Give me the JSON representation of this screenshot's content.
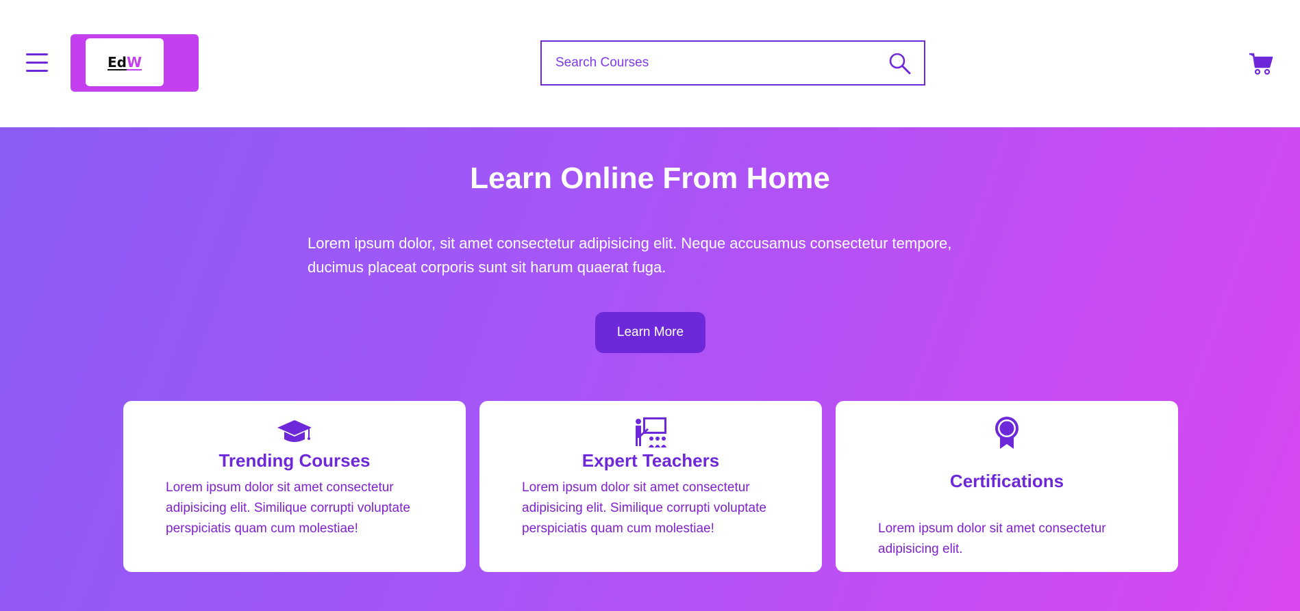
{
  "header": {
    "logo": {
      "part1": "Ed",
      "part2": "W"
    },
    "search": {
      "placeholder": "Search Courses"
    }
  },
  "hero": {
    "title": "Learn Online From Home",
    "description": "Lorem ipsum dolor, sit amet consectetur adipisicing elit. Neque accusamus consectetur tempore, ducimus placeat corporis sunt sit harum quaerat fuga.",
    "cta_label": "Learn More"
  },
  "features": [
    {
      "icon": "graduation-cap-icon",
      "title": "Trending Courses",
      "text": "Lorem ipsum dolor sit amet consectetur adipisicing elit. Similique corrupti voluptate perspiciatis quam cum molestiae!"
    },
    {
      "icon": "teacher-presentation-icon",
      "title": "Expert Teachers",
      "text": "Lorem ipsum dolor sit amet consectetur adipisicing elit. Similique corrupti voluptate perspiciatis quam cum molestiae!"
    },
    {
      "icon": "award-ribbon-icon",
      "title": "Certifications",
      "text": "Lorem ipsum dolor sit amet consectetur adipisicing elit."
    }
  ],
  "colors": {
    "accent": "#6d28d9",
    "logo_bg": "#c33ff0",
    "gradient_start": "#8b5cf6",
    "gradient_end": "#d946ef"
  }
}
